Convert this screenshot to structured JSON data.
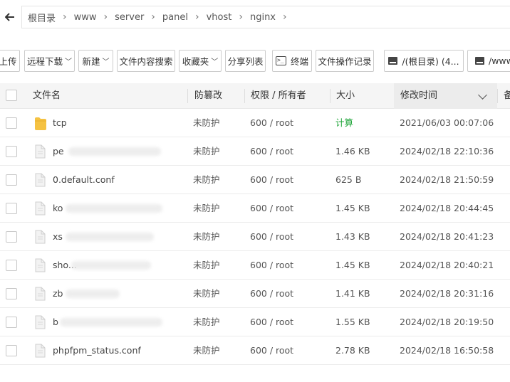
{
  "breadcrumb": {
    "items": [
      "根目录",
      "www",
      "server",
      "panel",
      "vhost",
      "nginx"
    ]
  },
  "toolbar": {
    "upload_label": "上传",
    "remote_download_label": "远程下载",
    "new_label": "新建",
    "content_search_label": "文件内容搜索",
    "favorites_label": "收藏夹",
    "share_list_label": "分享列表",
    "terminal_label": "终端",
    "operation_log_label": "文件操作记录",
    "disk1_label": "/(根目录) (4...",
    "disk2_label": "/www"
  },
  "table": {
    "columns": {
      "name": "文件名",
      "protect": "防篡改",
      "permission": "权限 / 所有者",
      "size": "大小",
      "mtime": "修改时间",
      "extra": "备"
    },
    "rows": [
      {
        "type": "folder",
        "name": "tcp",
        "protect": "未防护",
        "permission": "600 / root",
        "size": "计算",
        "mtime": "2021/06/03 00:07:06"
      },
      {
        "type": "file",
        "name": "pe",
        "protect": "未防护",
        "permission": "600 / root",
        "size": "1.46 KB",
        "mtime": "2024/02/18 22:10:36"
      },
      {
        "type": "file",
        "name": "0.default.conf",
        "protect": "未防护",
        "permission": "600 / root",
        "size": "625 B",
        "mtime": "2024/02/18 21:50:59"
      },
      {
        "type": "file",
        "name": "ko",
        "protect": "未防护",
        "permission": "600 / root",
        "size": "1.45 KB",
        "mtime": "2024/02/18 20:44:45"
      },
      {
        "type": "file",
        "name": "xs",
        "protect": "未防护",
        "permission": "600 / root",
        "size": "1.43 KB",
        "mtime": "2024/02/18 20:41:23"
      },
      {
        "type": "file",
        "name": "sho...",
        "protect": "未防护",
        "permission": "600 / root",
        "size": "1.45 KB",
        "mtime": "2024/02/18 20:40:21"
      },
      {
        "type": "file",
        "name": "zb",
        "protect": "未防护",
        "permission": "600 / root",
        "size": "1.41 KB",
        "mtime": "2024/02/18 20:31:16"
      },
      {
        "type": "file",
        "name": "b",
        "protect": "未防护",
        "permission": "600 / root",
        "size": "1.55 KB",
        "mtime": "2024/02/18 20:19:50"
      },
      {
        "type": "file",
        "name": "phpfpm_status.conf",
        "protect": "未防护",
        "permission": "600 / root",
        "size": "2.78 KB",
        "mtime": "2024/02/18 16:50:58"
      }
    ]
  },
  "colors": {
    "accent_green": "#20a53a",
    "folder": "#f5c242"
  }
}
